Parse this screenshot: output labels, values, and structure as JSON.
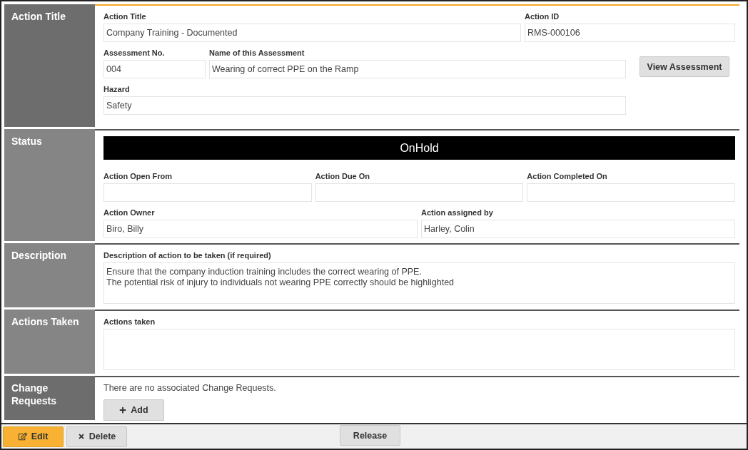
{
  "sections": [
    {
      "kind": "title",
      "label": "Action Title",
      "fields": [
        {
          "label": "Action Title",
          "value": "Company Training - Documented"
        },
        {
          "label": "Action ID",
          "value": "RMS-000106"
        },
        {
          "label": "Assessment No.",
          "value": "004"
        },
        {
          "label": "Name of this Assessment",
          "value": "Wearing of correct PPE on the Ramp"
        },
        {
          "label": "Hazard",
          "value": "Safety"
        }
      ],
      "button": "View Assessment"
    },
    {
      "kind": "status",
      "label": "Status",
      "status": "OnHold",
      "fields": [
        {
          "label": "Action Open From"
        },
        {
          "label": "Action Due On"
        },
        {
          "label": "Action Completed On"
        },
        {
          "label": "Action Owner",
          "value": "Biro, Billy"
        },
        {
          "label": "Action assigned by",
          "value": "Harley, Colin"
        }
      ]
    },
    {
      "kind": "text",
      "label": "Description",
      "fields": [
        {
          "label": "Description of action to be taken (if required)",
          "lines": [
            "Ensure that the company induction training includes the correct wearing of PPE.",
            "The potential risk of injury to individuals not wearing PPE correctly should be highlighted"
          ]
        }
      ]
    },
    {
      "kind": "text",
      "label": "Actions Taken",
      "fields": [
        {
          "label": "Actions taken"
        }
      ]
    },
    {
      "kind": "changes",
      "label": "Change Requests",
      "message": "There are no associated Change Requests.",
      "button": "Add"
    }
  ],
  "footer": {
    "edit": "Edit",
    "delete": "Delete",
    "release": "Release"
  }
}
